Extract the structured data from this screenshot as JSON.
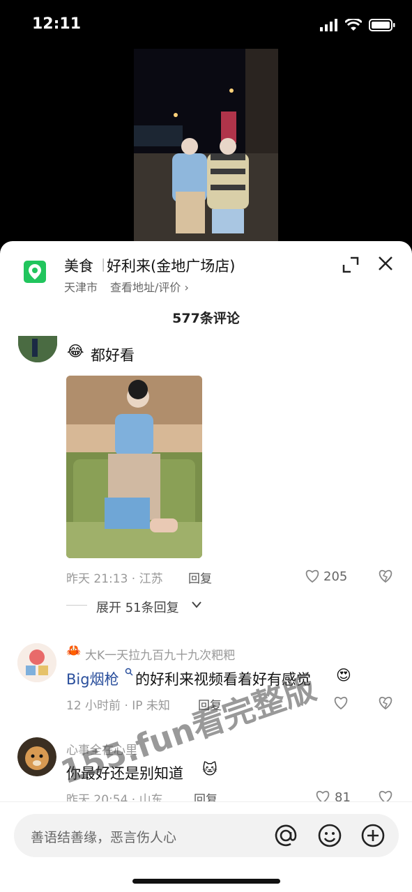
{
  "status": {
    "time": "12:11"
  },
  "poi": {
    "category": "美食",
    "separator": "|",
    "name": "好利来(金地广场店)",
    "city": "天津市",
    "link": "查看地址/评价 ›",
    "icon": "location-pin-icon"
  },
  "comments_header": "577条评论",
  "comments": [
    {
      "text": "都好看",
      "emoji": "😂",
      "time_location": "昨天 21:13 · 江苏",
      "reply_label": "回复",
      "likes": "205",
      "expand_label": "展开 51条回复"
    },
    {
      "username": "大K一天拉九百九十九次粑粑",
      "username_emoji": "🦀",
      "mention": "Big烟枪",
      "text": "的好利来视频看着好有感觉",
      "emoji": "😍",
      "time_location": "12 小时前 · IP 未知",
      "reply_label": "回复"
    },
    {
      "username": "心事全在心里",
      "text": "你最好还是别知道",
      "emoji": "🐱",
      "time_location": "昨天 20:54 · 山东",
      "reply_label": "回复",
      "likes": "81"
    }
  ],
  "watermark": "155.fun看完整版",
  "input": {
    "placeholder": "善语结善缘，恶言伤人心"
  },
  "colors": {
    "poi_green": "#21c55d",
    "mention_blue": "#2a4f9c",
    "sheet_bg": "#ffffff"
  }
}
